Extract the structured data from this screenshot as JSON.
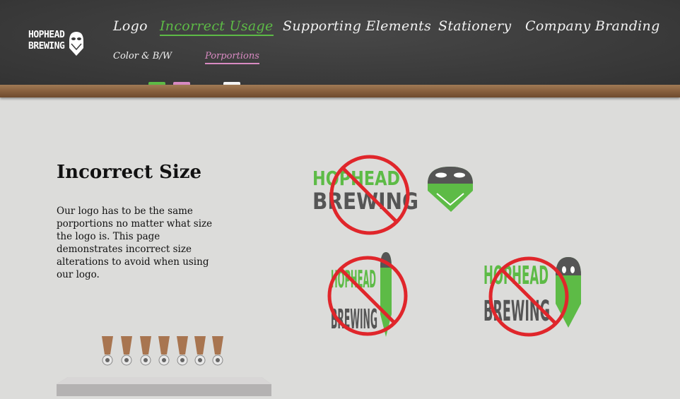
{
  "brand": {
    "logo_line1": "HOPHEAD",
    "logo_line2": "BREWING",
    "logo_icon": "ghost-hop-icon"
  },
  "nav": {
    "items": [
      {
        "label": "Logo",
        "active": false
      },
      {
        "label": "Incorrect Usage",
        "active": true
      },
      {
        "label": "Supporting Elements",
        "active": false
      },
      {
        "label": "Stationery",
        "active": false
      },
      {
        "label": "Company Branding",
        "active": false
      }
    ],
    "subitems": [
      {
        "label": "Color & B/W",
        "active": false
      },
      {
        "label": "Porportions",
        "active": true
      }
    ]
  },
  "colors": {
    "accent_green": "#5dbb46",
    "accent_pink": "#d88ac2",
    "prohibit_red": "#e0262b",
    "logo_gray": "#555555"
  },
  "content": {
    "heading": "Incorrect Size",
    "description": "Our logo has to be the same porportions no matter what size the logo is. This page demonstrates incorrect size alterations to avoid when using our logo."
  },
  "examples": [
    {
      "variant": "stretched-horizontal",
      "line1": "HOPHEAD",
      "line2": "BREWING",
      "icon": "no-symbol-icon"
    },
    {
      "variant": "squeezed-narrow",
      "line1": "HOPHEAD",
      "line2": "BREWING",
      "icon": "no-symbol-icon"
    },
    {
      "variant": "stretched-vertical",
      "line1": "HOPHEAD",
      "line2": "BREWING",
      "icon": "no-symbol-icon"
    }
  ]
}
